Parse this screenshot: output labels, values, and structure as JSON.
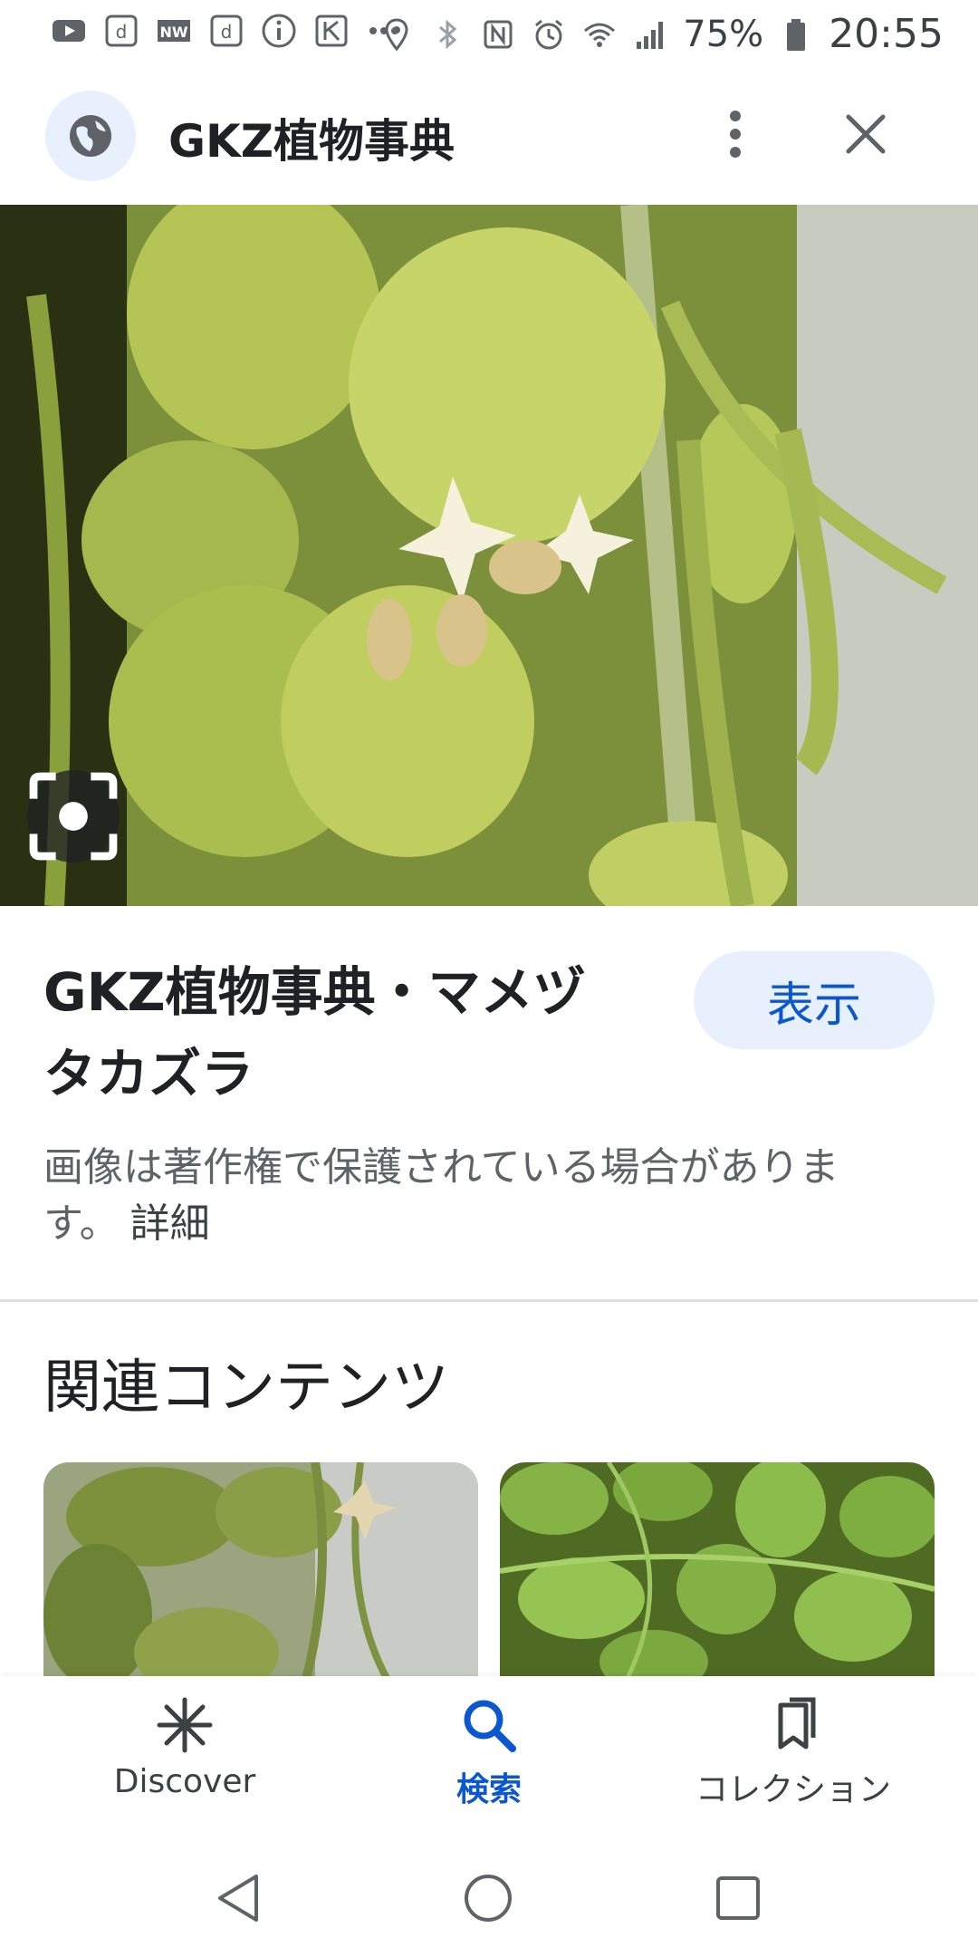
{
  "status_bar": {
    "battery": "75%",
    "time": "20:55",
    "icons_left": [
      "youtube-icon",
      "d-app-icon",
      "news-icon",
      "d-app-icon",
      "info-icon",
      "k-app-icon",
      "more-icon"
    ],
    "icons_right": [
      "location-icon",
      "bluetooth-icon",
      "nfc-icon",
      "alarm-icon",
      "wifi-icon",
      "signal-icon",
      "battery-icon"
    ]
  },
  "header": {
    "title": "GKZ植物事典",
    "site_icon": "globe-icon",
    "menu_icon": "more-vert-icon",
    "close_icon": "close-icon"
  },
  "result": {
    "title": "GKZ植物事典・マメヅタカズラ",
    "view_button": "表示",
    "copyright_text": "画像は著作権で保護されている場合があります。",
    "details_link": "詳細"
  },
  "related": {
    "heading": "関連コンテンツ"
  },
  "bottom_nav": {
    "items": [
      {
        "label": "Discover",
        "icon": "asterisk-icon"
      },
      {
        "label": "検索",
        "icon": "search-icon"
      },
      {
        "label": "コレクション",
        "icon": "collections-icon"
      }
    ]
  },
  "colors": {
    "accent": "#0b57d0",
    "button_bg": "#e8f0fe"
  }
}
